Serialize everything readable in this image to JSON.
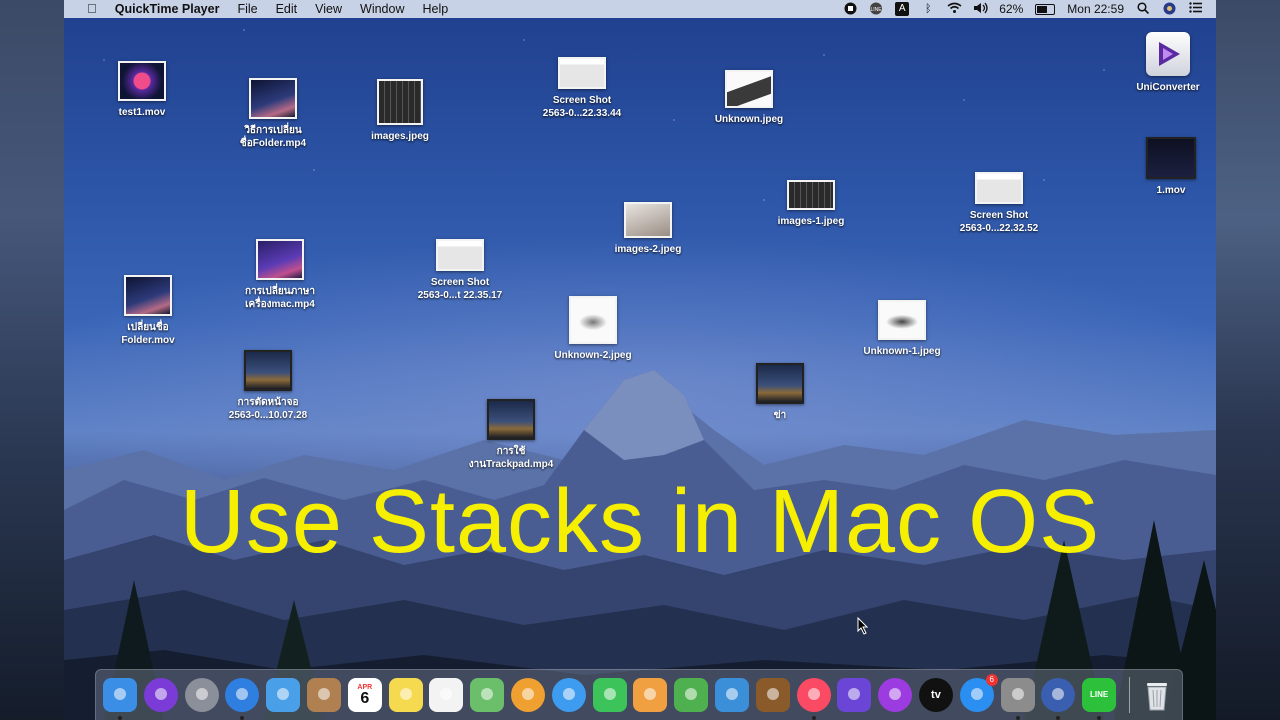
{
  "menubar": {
    "apple": "",
    "app_name": "QuickTime Player",
    "menus": [
      "File",
      "Edit",
      "View",
      "Window",
      "Help"
    ],
    "battery_percent": "62%",
    "battery_level": 0.62,
    "clock": "Mon 22:59",
    "input_source": "A"
  },
  "desktop_icons": [
    {
      "name": "test1.mov",
      "thumb": "video"
    },
    {
      "name": "วิธีการเปลี่ยน\nชื่อFolder.mp4",
      "thumb": "video"
    },
    {
      "name": "images.jpeg",
      "thumb": "keyboard"
    },
    {
      "name": "Screen Shot\n2563-0...22.33.44",
      "thumb": "screenshot"
    },
    {
      "name": "Unknown.jpeg",
      "thumb": "laptop"
    },
    {
      "name": "UniConverter",
      "thumb": "app"
    },
    {
      "name": "1.mov",
      "thumb": "dark"
    },
    {
      "name": "images-1.jpeg",
      "thumb": "keyboard"
    },
    {
      "name": "Screen Shot\n2563-0...22.32.52",
      "thumb": "screenshot"
    },
    {
      "name": "images-2.jpeg",
      "thumb": "keyboard"
    },
    {
      "name": "การเปลี่ยนภาษา\nเครื่องmac.mp4",
      "thumb": "video"
    },
    {
      "name": "Screen Shot\n2563-0...t 22.35.17",
      "thumb": "screenshot"
    },
    {
      "name": "เปลี่ยนชื่อ\nFolder.mov",
      "thumb": "video"
    },
    {
      "name": "Unknown-2.jpeg",
      "thumb": "white"
    },
    {
      "name": "Unknown-1.jpeg",
      "thumb": "white"
    },
    {
      "name": "การตัดหน้าจอ\n2563-0...10.07.28",
      "thumb": "catalina"
    },
    {
      "name": "ข่า",
      "thumb": "catalina"
    },
    {
      "name": "การใช้\nงานTrackpad.mp4",
      "thumb": "catalina"
    }
  ],
  "overlay_title": "Use Stacks in Mac OS",
  "dock": {
    "apps": [
      {
        "icon": "finder-icon",
        "color": "#3a8ee6",
        "running": true
      },
      {
        "icon": "siri-icon",
        "color": "#7a3bd6",
        "running": false
      },
      {
        "icon": "launchpad-icon",
        "color": "#8a8f99",
        "running": false
      },
      {
        "icon": "safari-icon",
        "color": "#2f7fe0",
        "running": true
      },
      {
        "icon": "mail-icon",
        "color": "#4aa0e8",
        "running": false
      },
      {
        "icon": "contacts-icon",
        "color": "#b08050",
        "running": false
      },
      {
        "icon": "calendar-icon",
        "color": "#ffffff",
        "running": false,
        "month": "APR",
        "day": "6"
      },
      {
        "icon": "notes-icon",
        "color": "#f5d94e",
        "running": false
      },
      {
        "icon": "reminders-icon",
        "color": "#f3f3f3",
        "running": false
      },
      {
        "icon": "maps-icon",
        "color": "#6bbf6a",
        "running": false
      },
      {
        "icon": "photos-icon",
        "color": "#f0a030",
        "running": false
      },
      {
        "icon": "messages-icon",
        "color": "#3e9cf0",
        "running": false
      },
      {
        "icon": "facetime-icon",
        "color": "#3cc45a",
        "running": false
      },
      {
        "icon": "pages-icon",
        "color": "#f0a040",
        "running": false
      },
      {
        "icon": "numbers-icon",
        "color": "#4fb04f",
        "running": false
      },
      {
        "icon": "keynote-icon",
        "color": "#3b8fd9",
        "running": false
      },
      {
        "icon": "garageband-icon",
        "color": "#8a5a2a",
        "running": false
      },
      {
        "icon": "music-icon",
        "color": "#fb4a63",
        "running": true
      },
      {
        "icon": "imovie-icon",
        "color": "#6b46d6",
        "running": false
      },
      {
        "icon": "podcasts-icon",
        "color": "#9b3be0",
        "running": false
      },
      {
        "icon": "tv-icon",
        "color": "#111111",
        "running": false,
        "label": "tv"
      },
      {
        "icon": "app-store-icon",
        "color": "#2a8ff0",
        "running": false,
        "badge": "6"
      },
      {
        "icon": "system-preferences-icon",
        "color": "#8c8c8c",
        "running": true
      },
      {
        "icon": "quicktime-icon",
        "color": "#3a5fb0",
        "running": true
      },
      {
        "icon": "line-icon",
        "color": "#2cc03b",
        "running": true,
        "label": "LINE"
      }
    ],
    "trash": {
      "icon": "trash-icon"
    }
  }
}
